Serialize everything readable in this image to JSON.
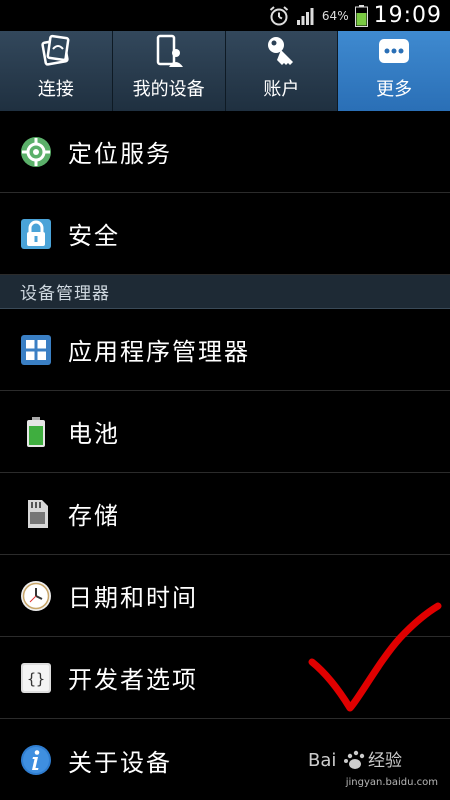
{
  "status_bar": {
    "battery_percent": "64%",
    "time": "19:09",
    "icons": [
      "alarm-icon",
      "signal-icon",
      "battery-icon"
    ]
  },
  "tabs": [
    {
      "label": "连接",
      "icon": "connection-icon"
    },
    {
      "label": "我的设备",
      "icon": "my-device-icon"
    },
    {
      "label": "账户",
      "icon": "key-icon"
    },
    {
      "label": "更多",
      "icon": "more-icon",
      "active": true
    }
  ],
  "items_top": [
    {
      "label": "定位服务",
      "icon": "location-icon"
    },
    {
      "label": "安全",
      "icon": "lock-icon"
    }
  ],
  "section": {
    "label": "设备管理器"
  },
  "items_bottom": [
    {
      "label": "应用程序管理器",
      "icon": "app-grid-icon"
    },
    {
      "label": "电池",
      "icon": "battery-icon"
    },
    {
      "label": "存储",
      "icon": "sd-card-icon"
    },
    {
      "label": "日期和时间",
      "icon": "clock-icon"
    },
    {
      "label": "开发者选项",
      "icon": "braces-icon"
    },
    {
      "label": "关于设备",
      "icon": "info-icon"
    }
  ],
  "colors": {
    "active_tab": "#3a85cc",
    "check_mark": "#e00000",
    "section_bg": "#1e2a35"
  },
  "watermark": {
    "logo_text": "Bai度经验",
    "url": "jingyan.baidu.com"
  }
}
